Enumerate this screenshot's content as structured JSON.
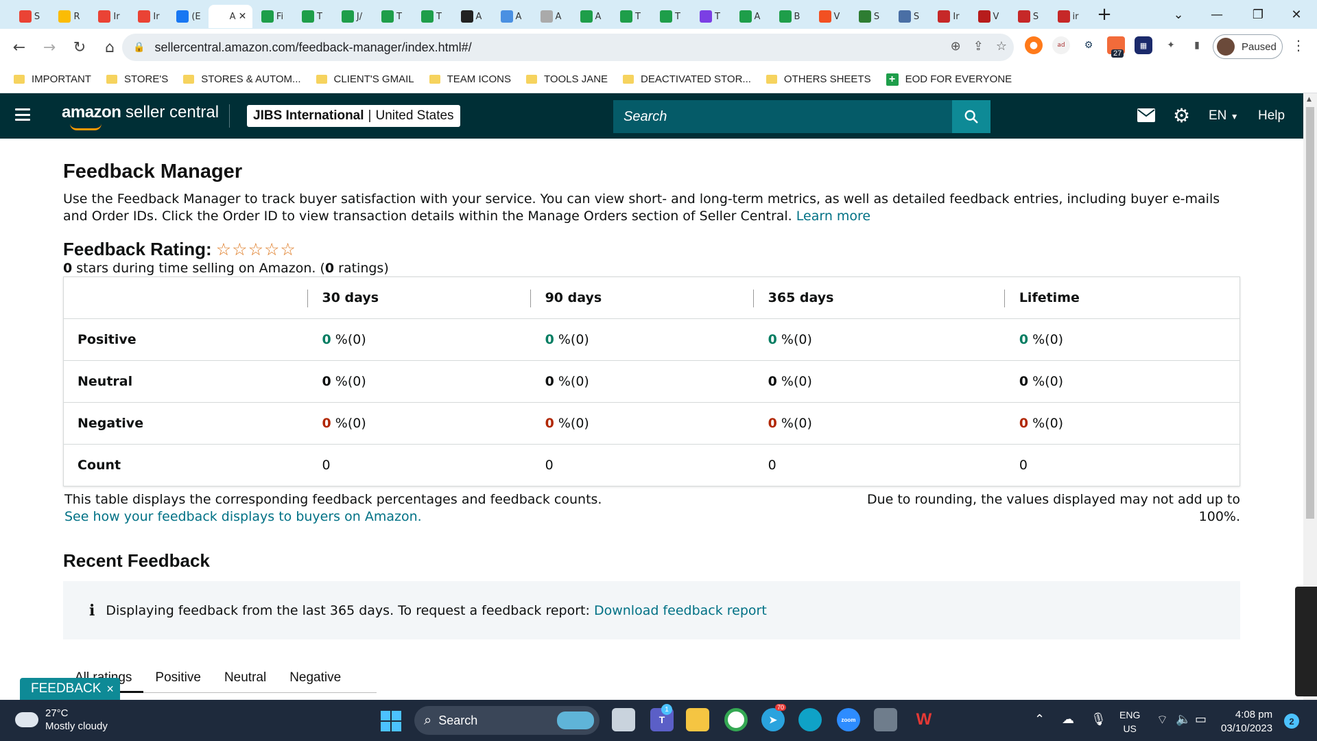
{
  "browser": {
    "tabs": [
      {
        "label": "S",
        "icon": "gmail-icon",
        "color": "#ea4335"
      },
      {
        "label": "R",
        "icon": "drive-icon",
        "color": "#fbbc04"
      },
      {
        "label": "Ir",
        "icon": "gmail-icon",
        "color": "#ea4335"
      },
      {
        "label": "Ir",
        "icon": "gmail-icon",
        "color": "#ea4335"
      },
      {
        "label": "(E",
        "icon": "facebook-icon",
        "color": "#1877f2"
      },
      {
        "label": "A",
        "icon": "amazon-icon",
        "color": "#ffffff",
        "active": true
      },
      {
        "label": "Fi",
        "icon": "sheets-icon",
        "color": "#1e9e4a"
      },
      {
        "label": "T",
        "icon": "sheets-icon",
        "color": "#1e9e4a"
      },
      {
        "label": "J/",
        "icon": "sheets-icon",
        "color": "#1e9e4a"
      },
      {
        "label": "T",
        "icon": "sheets-icon",
        "color": "#1e9e4a"
      },
      {
        "label": "T",
        "icon": "sheets-icon",
        "color": "#1e9e4a"
      },
      {
        "label": "A",
        "icon": "c-icon",
        "color": "#222222"
      },
      {
        "label": "A",
        "icon": "pencil-icon",
        "color": "#4a90e2"
      },
      {
        "label": "A",
        "icon": "globe-icon",
        "color": "#aaaaaa"
      },
      {
        "label": "A",
        "icon": "sheets-icon",
        "color": "#1e9e4a"
      },
      {
        "label": "T",
        "icon": "sheets-icon",
        "color": "#1e9e4a"
      },
      {
        "label": "T",
        "icon": "sheets-icon",
        "color": "#1e9e4a"
      },
      {
        "label": "T",
        "icon": "messenger-icon",
        "color": "#7b3fe4"
      },
      {
        "label": "A",
        "icon": "sheets-icon",
        "color": "#1e9e4a"
      },
      {
        "label": "B",
        "icon": "sheets-icon",
        "color": "#1e9e4a"
      },
      {
        "label": "V",
        "icon": "windows-icon",
        "color": "#f25022"
      },
      {
        "label": "S",
        "icon": "w-icon",
        "color": "#2e7d32"
      },
      {
        "label": "S",
        "icon": "cloud-icon",
        "color": "#4a6fa5"
      },
      {
        "label": "Ir",
        "icon": "tc-icon",
        "color": "#c62828"
      },
      {
        "label": "V",
        "icon": "vw-icon",
        "color": "#b71c1c"
      },
      {
        "label": "S",
        "icon": "cb-icon",
        "color": "#c62828"
      },
      {
        "label": "ir",
        "icon": "v-icon",
        "color": "#c62828"
      }
    ],
    "url": "sellercentral.amazon.com/feedback-manager/index.html#/",
    "profile_status": "Paused",
    "extension_badge": "27",
    "bookmarks": [
      {
        "label": "IMPORTANT",
        "type": "folder"
      },
      {
        "label": "STORE'S",
        "type": "folder"
      },
      {
        "label": "STORES & AUTOM...",
        "type": "folder"
      },
      {
        "label": "CLIENT'S GMAIL",
        "type": "folder"
      },
      {
        "label": "TEAM ICONS",
        "type": "folder"
      },
      {
        "label": "TOOLS JANE",
        "type": "folder"
      },
      {
        "label": "DEACTIVATED STOR...",
        "type": "folder"
      },
      {
        "label": "OTHERS SHEETS",
        "type": "folder"
      },
      {
        "label": "EOD FOR EVERYONE",
        "type": "sheet"
      }
    ]
  },
  "header": {
    "logo_bold": "amazon",
    "logo_rest": " seller central",
    "account_name": "JIBS International",
    "account_sep": "|",
    "account_region": "United States",
    "search_placeholder": "Search",
    "language": "EN",
    "help": "Help",
    "colors": {
      "bar": "#002f36",
      "search_bg": "#055b68",
      "search_button": "#0e8a96"
    }
  },
  "page": {
    "title": "Feedback Manager",
    "intro": "Use the Feedback Manager to track buyer satisfaction with your service. You can view short- and long-term metrics, as well as detailed feedback entries, including buyer e-mails and Order IDs. Click the Order ID to view transaction details within the Manage Orders section of Seller Central.",
    "learn_more": "Learn more",
    "rating_label": "Feedback Rating:",
    "rating_stars": 0,
    "rating_stars_max": 5,
    "rating_value": "0",
    "rating_text_mid": " stars during time selling on Amazon. (",
    "rating_count": "0",
    "rating_text_end": " ratings)",
    "table": {
      "columns": [
        "30 days",
        "90 days",
        "365 days",
        "Lifetime"
      ],
      "rows": [
        {
          "label": "Positive",
          "style": "g",
          "cells": [
            [
              "0",
              " %(0)"
            ],
            [
              "0",
              " %(0)"
            ],
            [
              "0",
              " %(0)"
            ],
            [
              "0",
              " %(0)"
            ]
          ]
        },
        {
          "label": "Neutral",
          "style": "k",
          "cells": [
            [
              "0",
              " %(0)"
            ],
            [
              "0",
              " %(0)"
            ],
            [
              "0",
              " %(0)"
            ],
            [
              "0",
              " %(0)"
            ]
          ]
        },
        {
          "label": "Negative",
          "style": "r",
          "cells": [
            [
              "0",
              " %(0)"
            ],
            [
              "0",
              " %(0)"
            ],
            [
              "0",
              " %(0)"
            ],
            [
              "0",
              " %(0)"
            ]
          ]
        },
        {
          "label": "Count",
          "style": "plain",
          "cells": [
            [
              "",
              "0"
            ],
            [
              "",
              "0"
            ],
            [
              "",
              "0"
            ],
            [
              "",
              "0"
            ]
          ]
        }
      ]
    },
    "table_note": "This table displays the corresponding feedback percentages and feedback counts.",
    "table_link": "See how your feedback displays to buyers on Amazon.",
    "rounding_note": "Due to rounding, the values displayed may not add up to 100%.",
    "recent_title": "Recent Feedback",
    "info_text": "Displaying feedback from the last 365 days. To request a feedback report: ",
    "info_link": "Download feedback report",
    "filter_tabs": [
      "All ratings",
      "Positive",
      "Neutral",
      "Negative"
    ],
    "active_filter": 0,
    "feedback_button": "FEEDBACK",
    "feedback_close": "×"
  },
  "taskbar": {
    "temperature": "27°C",
    "weather": "Mostly cloudy",
    "search": "Search",
    "lang_line1": "ENG",
    "lang_line2": "US",
    "time": "4:08 pm",
    "date": "03/10/2023",
    "notifications": "2",
    "telegram_badge": "70",
    "teams_badge": "1"
  }
}
